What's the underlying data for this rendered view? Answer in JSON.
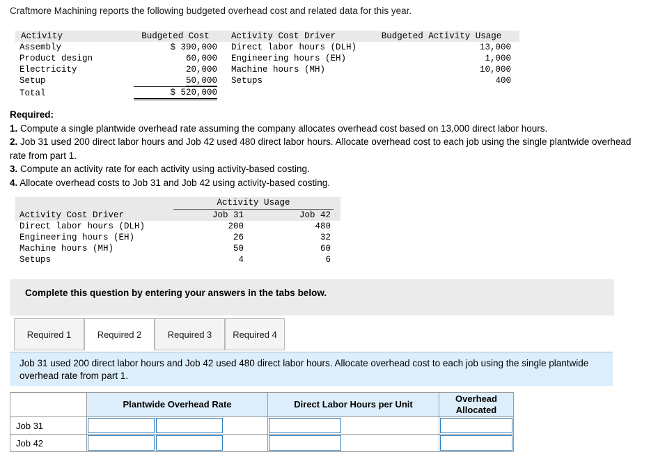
{
  "intro": "Craftmore Machining reports the following budgeted overhead cost and related data for this year.",
  "table1": {
    "headers": [
      "Activity",
      "Budgeted Cost",
      "Activity Cost Driver",
      "Budgeted Activity Usage"
    ],
    "rows": [
      {
        "activity": "Assembly",
        "cost": "$ 390,000",
        "driver": "Direct labor hours (DLH)",
        "usage": "13,000"
      },
      {
        "activity": "Product design",
        "cost": "60,000",
        "driver": "Engineering hours (EH)",
        "usage": "1,000"
      },
      {
        "activity": "Electricity",
        "cost": "20,000",
        "driver": "Machine hours (MH)",
        "usage": "10,000"
      },
      {
        "activity": "Setup",
        "cost": "50,000",
        "driver": "Setups",
        "usage": "400"
      }
    ],
    "total": {
      "activity": "Total",
      "cost": "$ 520,000",
      "driver": "",
      "usage": ""
    }
  },
  "required": {
    "heading": "Required:",
    "items": [
      {
        "num": "1.",
        "text": " Compute a single plantwide overhead rate assuming the company allocates overhead cost based on 13,000 direct labor hours."
      },
      {
        "num": "2.",
        "text": " Job 31 used 200 direct labor hours and Job 42 used 480 direct labor hours. Allocate overhead cost to each job using the single plantwide overhead rate from part 1."
      },
      {
        "num": "3.",
        "text": " Compute an activity rate for each activity using activity-based costing."
      },
      {
        "num": "4.",
        "text": " Allocate overhead costs to Job 31 and Job 42 using activity-based costing."
      }
    ]
  },
  "table2": {
    "group_header": "Activity Usage",
    "headers": [
      "Activity Cost Driver",
      "Job 31",
      "Job 42"
    ],
    "rows": [
      {
        "driver": "Direct labor hours (DLH)",
        "job31": "200",
        "job42": "480"
      },
      {
        "driver": "Engineering hours (EH)",
        "job31": "26",
        "job42": "32"
      },
      {
        "driver": "Machine hours (MH)",
        "job31": "50",
        "job42": "60"
      },
      {
        "driver": "Setups",
        "job31": "4",
        "job42": "6"
      }
    ]
  },
  "banner": {
    "text": "Complete this question by entering your answers in the tabs below."
  },
  "tabs": [
    {
      "label": "Required 1",
      "active": false
    },
    {
      "label": "Required 2",
      "active": true
    },
    {
      "label": "Required 3",
      "active": false
    },
    {
      "label": "Required 4",
      "active": false
    }
  ],
  "question": {
    "text": "Job 31 used 200 direct labor hours and Job 42 used 480 direct labor hours. Allocate overhead cost to each job using the single plantwide overhead rate from part 1."
  },
  "answer_table": {
    "headers": [
      "",
      "Plantwide Overhead Rate",
      "Direct Labor Hours per Unit",
      "Overhead Allocated"
    ],
    "overhead_allocated_line1": "Overhead",
    "overhead_allocated_line2": "Allocated",
    "rows": [
      {
        "label": "Job 31"
      },
      {
        "label": "Job 42"
      }
    ]
  },
  "colors": {
    "accent_blue": "#dceefb",
    "input_border": "#2f7fbf",
    "table_header_gray": "#e9e9e9",
    "banner_gray": "#ebebeb"
  }
}
